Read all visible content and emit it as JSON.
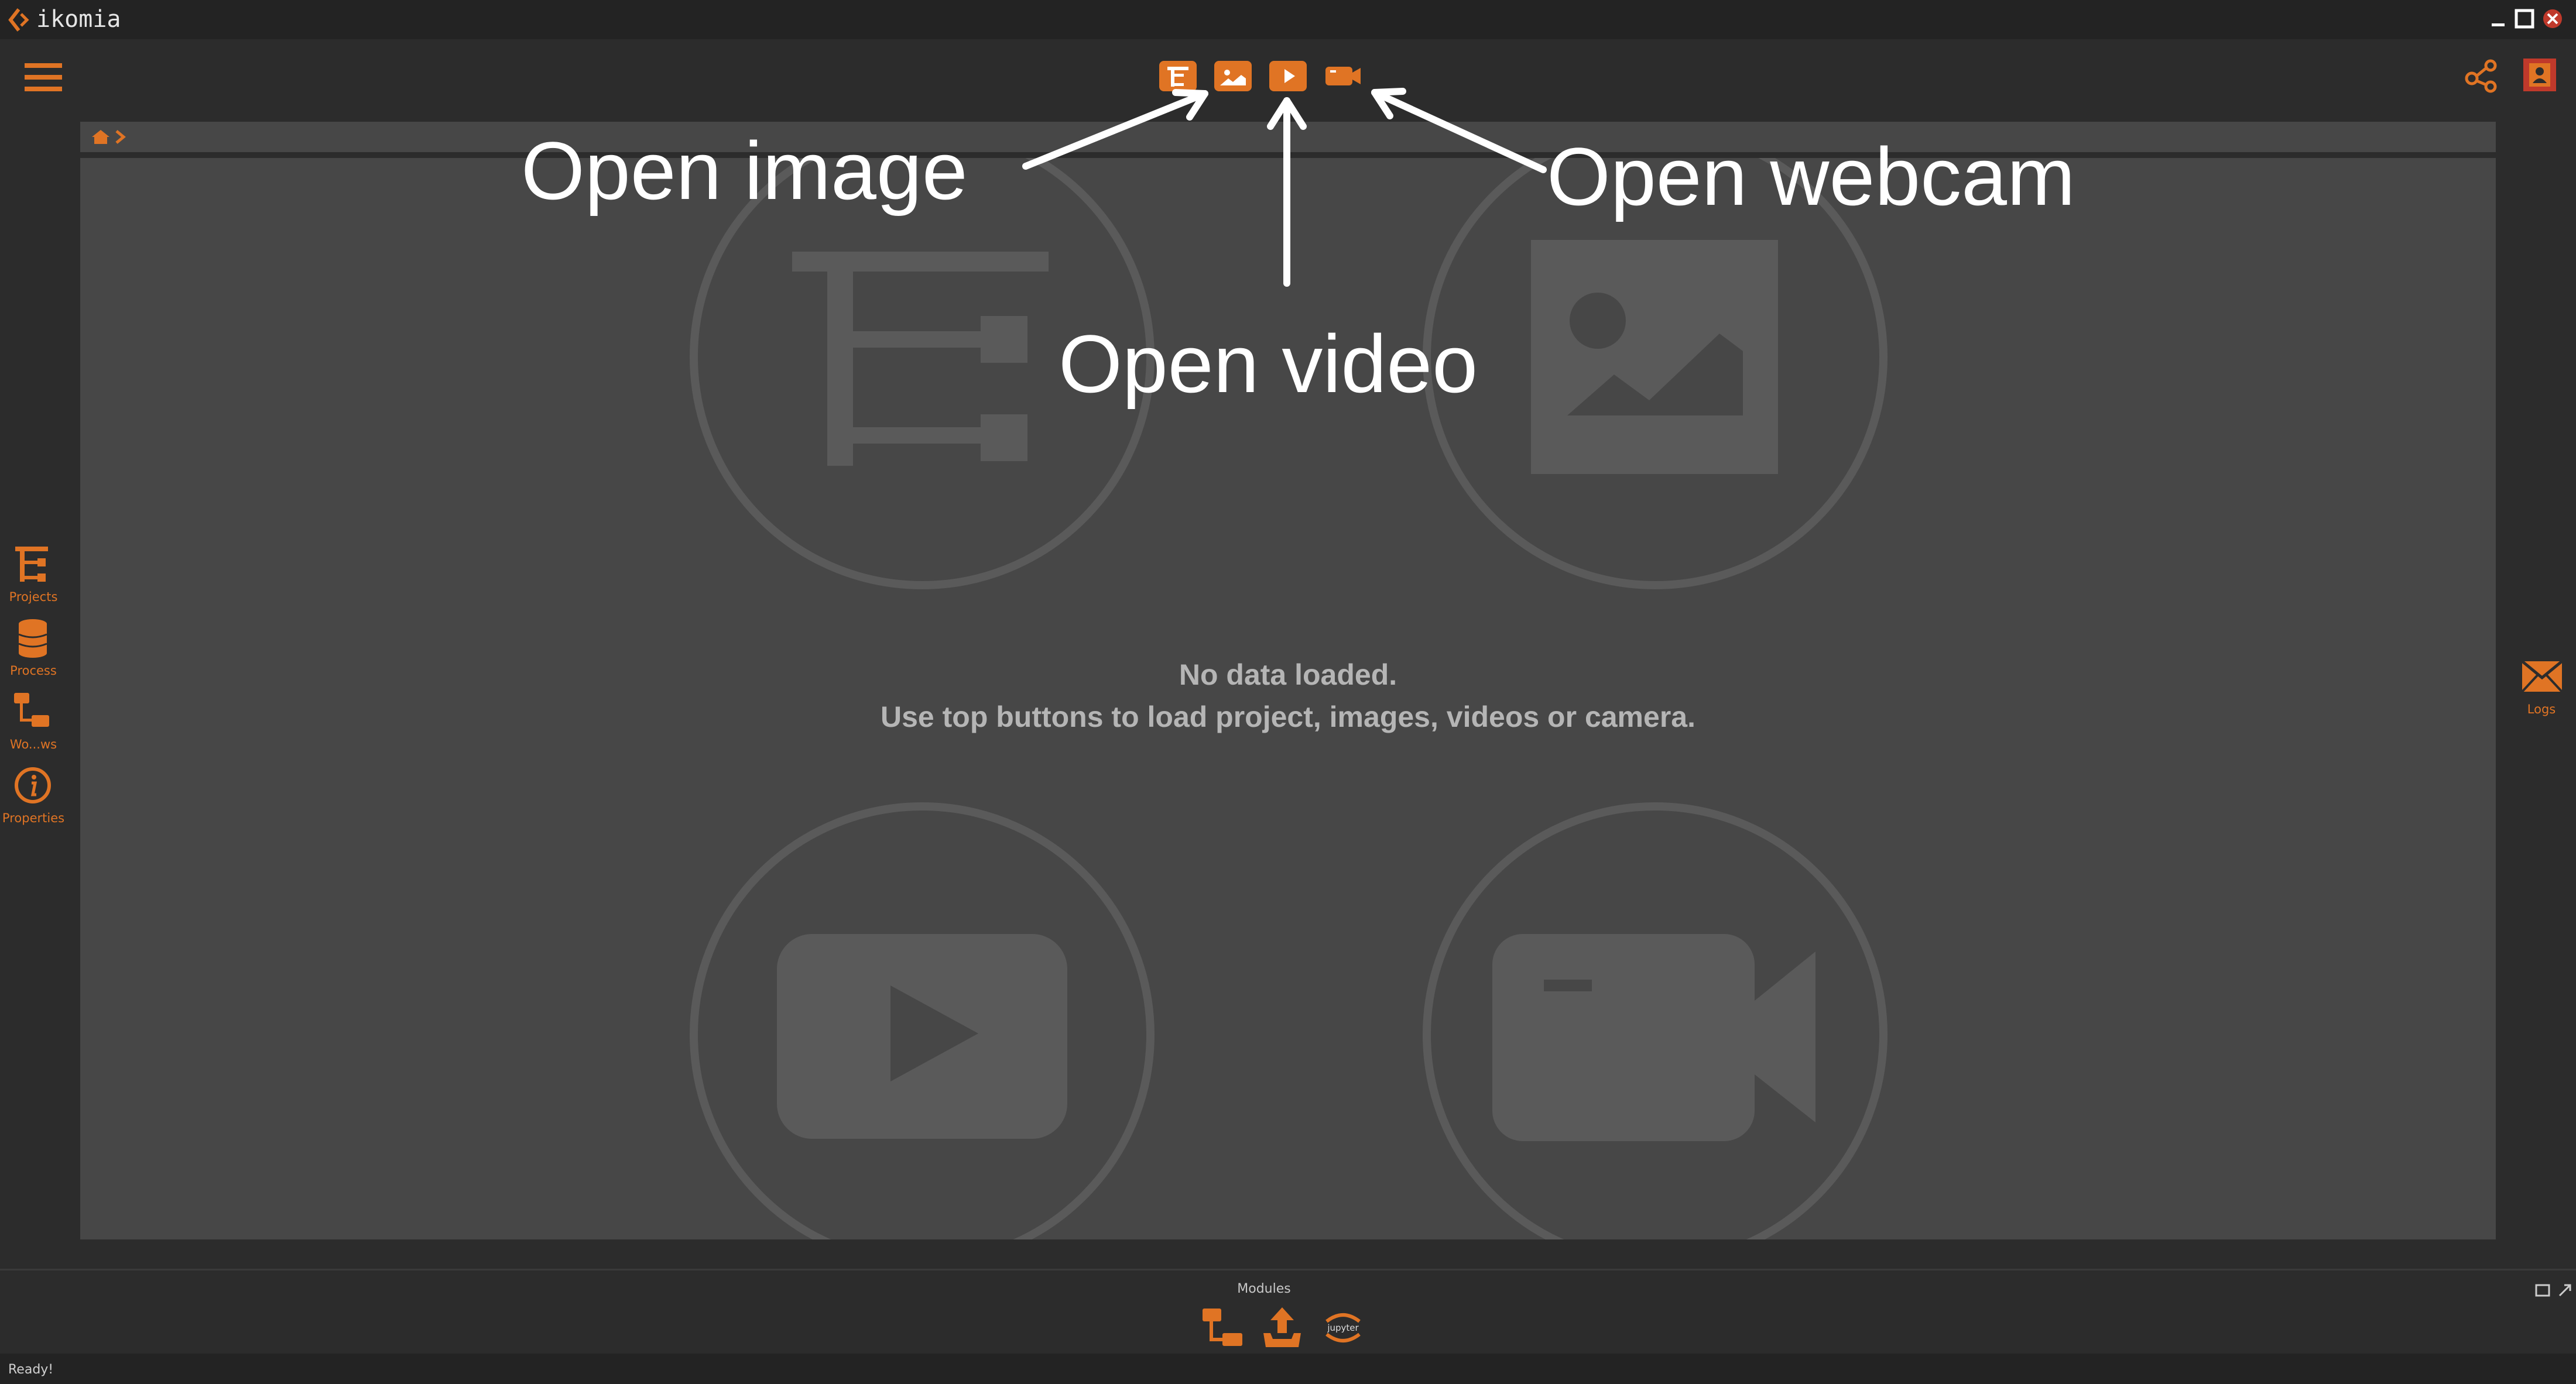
{
  "titlebar": {
    "app_name": "ikomia",
    "icons": [
      "ikomia-logo-icon",
      "minimize-icon",
      "maximize-icon",
      "close-icon"
    ]
  },
  "toolbar": {
    "menu_icon": "hamburger-menu-icon",
    "buttons": [
      {
        "name": "open-project-button",
        "icon": "project-tree-icon"
      },
      {
        "name": "open-image-button",
        "icon": "image-icon"
      },
      {
        "name": "open-video-button",
        "icon": "play-icon"
      },
      {
        "name": "open-webcam-button",
        "icon": "camera-icon"
      }
    ],
    "right_icons": [
      "share-icon",
      "user-icon"
    ]
  },
  "breadcrumb": {
    "icons": [
      "home-icon",
      "chevron-right-icon"
    ]
  },
  "annotations": {
    "open_image": "Open image",
    "open_video": "Open video",
    "open_webcam": "Open webcam"
  },
  "main": {
    "empty_line1": "No data loaded.",
    "empty_line2": "Use top buttons to load project, images, videos or camera.",
    "placeholder_icons": [
      "project-tree-icon",
      "image-icon",
      "play-icon",
      "camera-icon"
    ]
  },
  "sidebar": {
    "items": [
      {
        "label": "Projects",
        "icon": "project-tree-icon"
      },
      {
        "label": "Process",
        "icon": "database-icon"
      },
      {
        "label": "Wo...ws",
        "icon": "workflow-icon"
      },
      {
        "label": "Properties",
        "icon": "info-icon"
      }
    ]
  },
  "right_panel": {
    "logs_label": "Logs",
    "icon": "envelope-icon"
  },
  "modules": {
    "label": "Modules",
    "icons": [
      "workflow-icon",
      "plugin-upload-icon",
      "jupyter-icon"
    ],
    "jupyter_text": "jupyter",
    "corner_icons": [
      "float-icon",
      "expand-icon"
    ]
  },
  "status": {
    "text": "Ready!"
  },
  "colors": {
    "accent": "#e07424",
    "background": "#2c2c2c",
    "panel": "#474747",
    "titlebar": "#232323",
    "placeholder": "#5a5a5a",
    "annotation": "#ffffff"
  }
}
